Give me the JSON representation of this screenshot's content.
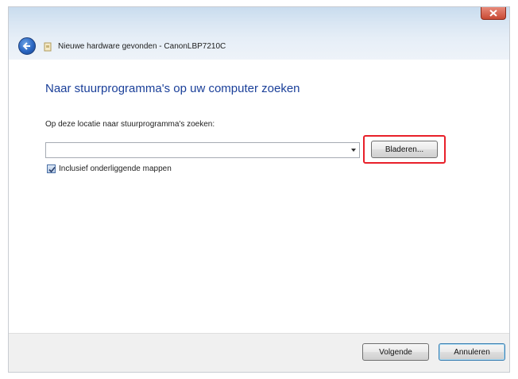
{
  "window": {
    "title": "Nieuwe hardware gevonden - CanonLBP7210C",
    "close_icon": "close-icon",
    "back_icon": "back-arrow-icon",
    "hardware_icon": "hardware-icon"
  },
  "main": {
    "heading": "Naar stuurprogramma's op uw computer zoeken",
    "location_label": "Op deze locatie naar stuurprogramma's zoeken:",
    "location_value": "",
    "browse_label": "Bladeren...",
    "include_subfolders_label": "Inclusief onderliggende mappen",
    "include_subfolders_checked": true
  },
  "footer": {
    "next_label": "Volgende",
    "cancel_label": "Annuleren"
  },
  "colors": {
    "heading": "#1a3f99",
    "highlight": "#e8202a"
  }
}
